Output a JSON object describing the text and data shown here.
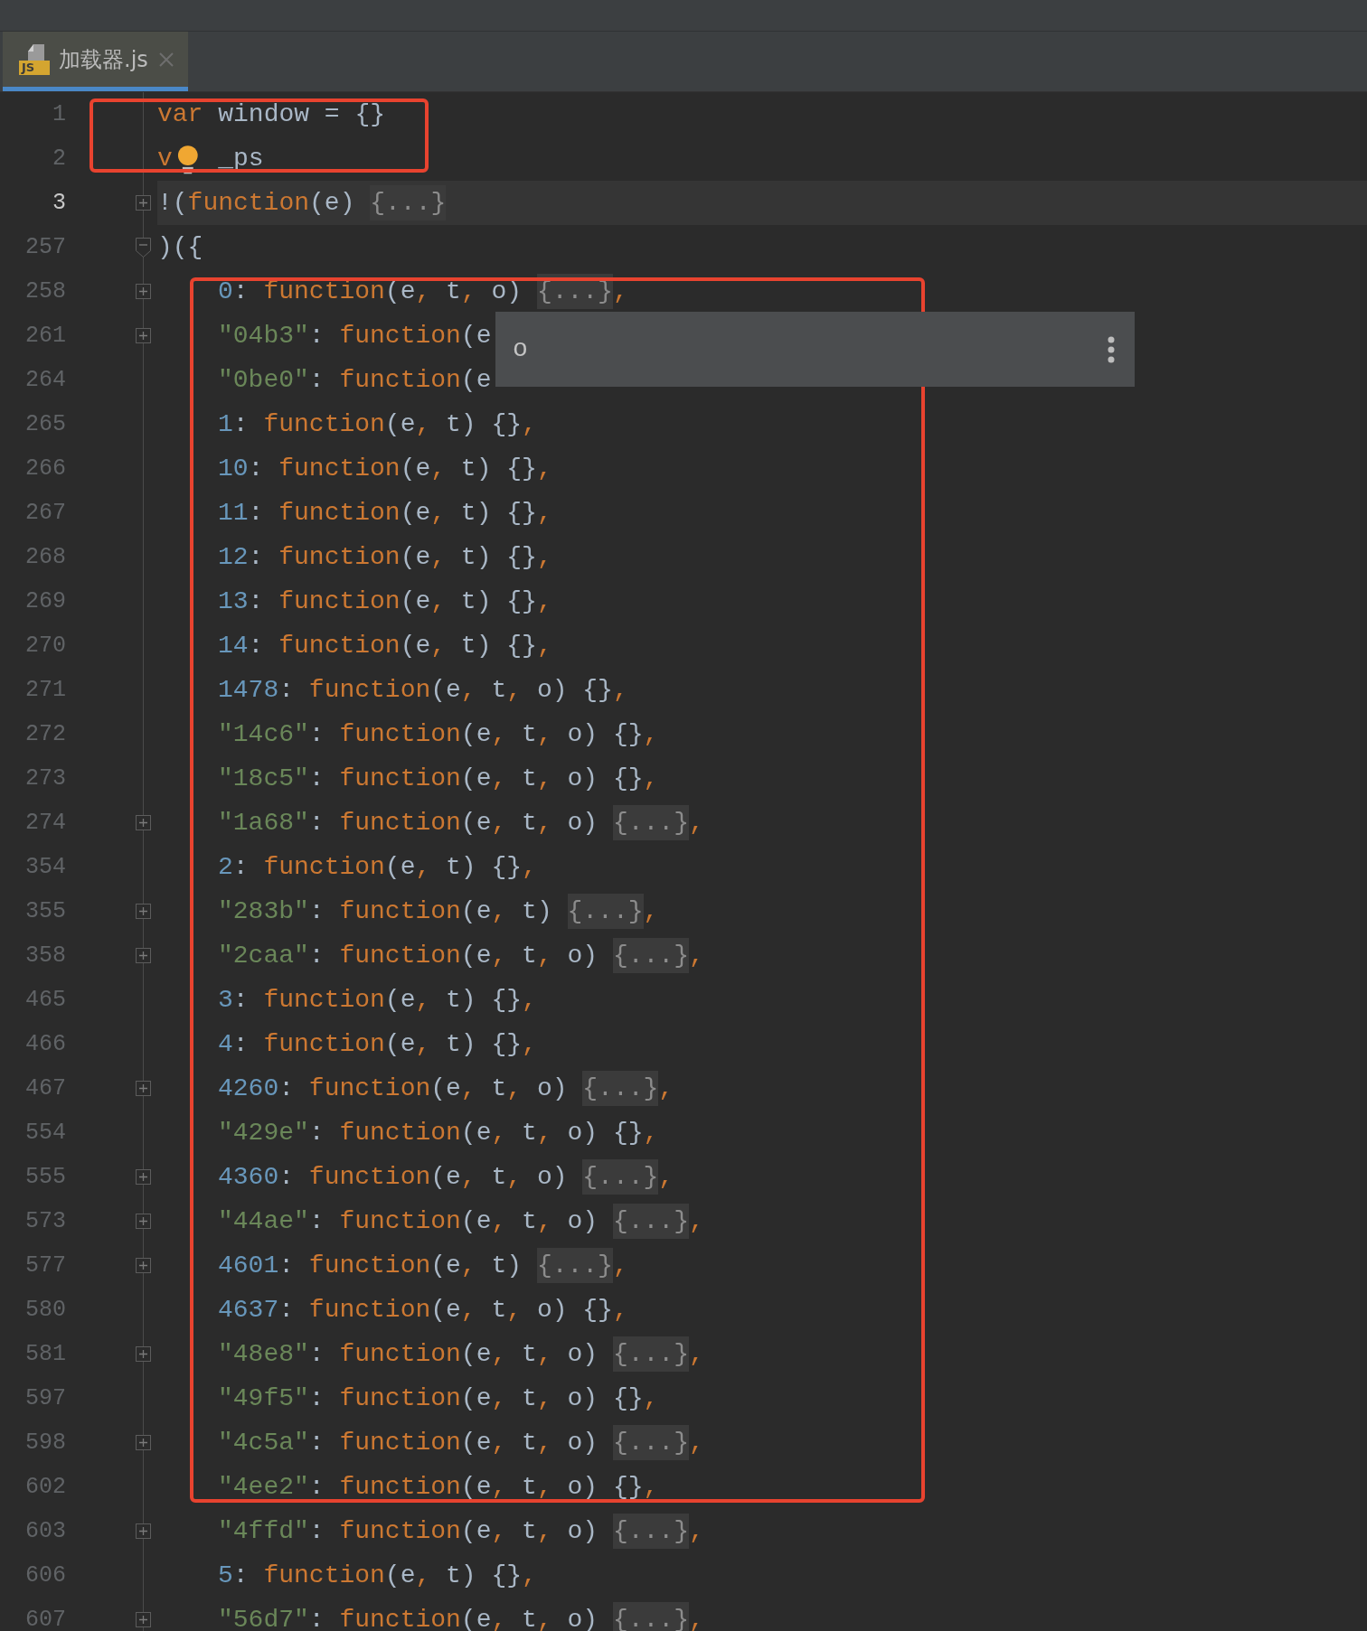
{
  "tab": {
    "title": "加载器.js",
    "icon_text": "JS",
    "selected": true
  },
  "lines": [
    {
      "number": "1",
      "current": false,
      "tokens": [
        {
          "kind": "keyword",
          "text": "var"
        },
        {
          "kind": "plain",
          "text": " window = {}"
        }
      ]
    },
    {
      "number": "2",
      "current": false,
      "tokens": [
        {
          "kind": "keyword",
          "text": "v"
        },
        {
          "kind": "bulb"
        },
        {
          "kind": "plain",
          "text": " _ps"
        }
      ]
    },
    {
      "number": "3",
      "current": true,
      "collapsed": true,
      "tokens": [
        {
          "kind": "plain",
          "text": "!("
        },
        {
          "kind": "keyword",
          "text": "function"
        },
        {
          "kind": "plain",
          "text": "(e) "
        },
        {
          "kind": "folded",
          "text": "{...}"
        }
      ]
    },
    {
      "number": "257",
      "current": false,
      "collapsed": false,
      "tokens": [
        {
          "kind": "plain",
          "text": ")({"
        }
      ],
      "children": [
        {
          "number": "258",
          "current": false,
          "collapsed": true,
          "tokens": [
            {
              "kind": "number",
              "text": "0"
            },
            {
              "kind": "plain",
              "text": ": "
            },
            {
              "kind": "keyword",
              "text": "function"
            },
            {
              "kind": "plain",
              "text": "(e"
            },
            {
              "kind": "keyword",
              "text": ", "
            },
            {
              "kind": "plain",
              "text": "t"
            },
            {
              "kind": "keyword",
              "text": ", "
            },
            {
              "kind": "plain",
              "text": "o) "
            },
            {
              "kind": "folded",
              "text": "{...}"
            },
            {
              "kind": "keyword",
              "text": ","
            }
          ]
        },
        {
          "number": "261",
          "current": false,
          "collapsed": true,
          "tokens": [
            {
              "kind": "string",
              "text": "\"04b3\""
            },
            {
              "kind": "plain",
              "text": ": "
            },
            {
              "kind": "keyword",
              "text": "function"
            },
            {
              "kind": "plain",
              "text": "(e"
            }
          ]
        },
        {
          "number": "264",
          "current": false,
          "tokens": [
            {
              "kind": "string",
              "text": "\"0be0\""
            },
            {
              "kind": "plain",
              "text": ": "
            },
            {
              "kind": "keyword",
              "text": "function"
            },
            {
              "kind": "plain",
              "text": "(e"
            }
          ]
        },
        {
          "number": "265",
          "current": false,
          "tokens": [
            {
              "kind": "number",
              "text": "1"
            },
            {
              "kind": "plain",
              "text": ": "
            },
            {
              "kind": "keyword",
              "text": "function"
            },
            {
              "kind": "plain",
              "text": "(e"
            },
            {
              "kind": "keyword",
              "text": ", "
            },
            {
              "kind": "plain",
              "text": "t) {}"
            },
            {
              "kind": "keyword",
              "text": ","
            }
          ]
        },
        {
          "number": "266",
          "current": false,
          "tokens": [
            {
              "kind": "number",
              "text": "10"
            },
            {
              "kind": "plain",
              "text": ": "
            },
            {
              "kind": "keyword",
              "text": "function"
            },
            {
              "kind": "plain",
              "text": "(e"
            },
            {
              "kind": "keyword",
              "text": ", "
            },
            {
              "kind": "plain",
              "text": "t) {}"
            },
            {
              "kind": "keyword",
              "text": ","
            }
          ]
        },
        {
          "number": "267",
          "current": false,
          "tokens": [
            {
              "kind": "number",
              "text": "11"
            },
            {
              "kind": "plain",
              "text": ": "
            },
            {
              "kind": "keyword",
              "text": "function"
            },
            {
              "kind": "plain",
              "text": "(e"
            },
            {
              "kind": "keyword",
              "text": ", "
            },
            {
              "kind": "plain",
              "text": "t) {}"
            },
            {
              "kind": "keyword",
              "text": ","
            }
          ]
        },
        {
          "number": "268",
          "current": false,
          "tokens": [
            {
              "kind": "number",
              "text": "12"
            },
            {
              "kind": "plain",
              "text": ": "
            },
            {
              "kind": "keyword",
              "text": "function"
            },
            {
              "kind": "plain",
              "text": "(e"
            },
            {
              "kind": "keyword",
              "text": ", "
            },
            {
              "kind": "plain",
              "text": "t) {}"
            },
            {
              "kind": "keyword",
              "text": ","
            }
          ]
        },
        {
          "number": "269",
          "current": false,
          "tokens": [
            {
              "kind": "number",
              "text": "13"
            },
            {
              "kind": "plain",
              "text": ": "
            },
            {
              "kind": "keyword",
              "text": "function"
            },
            {
              "kind": "plain",
              "text": "(e"
            },
            {
              "kind": "keyword",
              "text": ", "
            },
            {
              "kind": "plain",
              "text": "t) {}"
            },
            {
              "kind": "keyword",
              "text": ","
            }
          ]
        },
        {
          "number": "270",
          "current": false,
          "tokens": [
            {
              "kind": "number",
              "text": "14"
            },
            {
              "kind": "plain",
              "text": ": "
            },
            {
              "kind": "keyword",
              "text": "function"
            },
            {
              "kind": "plain",
              "text": "(e"
            },
            {
              "kind": "keyword",
              "text": ", "
            },
            {
              "kind": "plain",
              "text": "t) {}"
            },
            {
              "kind": "keyword",
              "text": ","
            }
          ]
        },
        {
          "number": "271",
          "current": false,
          "tokens": [
            {
              "kind": "number",
              "text": "1478"
            },
            {
              "kind": "plain",
              "text": ": "
            },
            {
              "kind": "keyword",
              "text": "function"
            },
            {
              "kind": "plain",
              "text": "(e"
            },
            {
              "kind": "keyword",
              "text": ", "
            },
            {
              "kind": "plain",
              "text": "t"
            },
            {
              "kind": "keyword",
              "text": ", "
            },
            {
              "kind": "plain",
              "text": "o) {}"
            },
            {
              "kind": "keyword",
              "text": ","
            }
          ]
        },
        {
          "number": "272",
          "current": false,
          "tokens": [
            {
              "kind": "string",
              "text": "\"14c6\""
            },
            {
              "kind": "plain",
              "text": ": "
            },
            {
              "kind": "keyword",
              "text": "function"
            },
            {
              "kind": "plain",
              "text": "(e"
            },
            {
              "kind": "keyword",
              "text": ", "
            },
            {
              "kind": "plain",
              "text": "t"
            },
            {
              "kind": "keyword",
              "text": ", "
            },
            {
              "kind": "plain",
              "text": "o) {}"
            },
            {
              "kind": "keyword",
              "text": ","
            }
          ]
        },
        {
          "number": "273",
          "current": false,
          "tokens": [
            {
              "kind": "string",
              "text": "\"18c5\""
            },
            {
              "kind": "plain",
              "text": ": "
            },
            {
              "kind": "keyword",
              "text": "function"
            },
            {
              "kind": "plain",
              "text": "(e"
            },
            {
              "kind": "keyword",
              "text": ", "
            },
            {
              "kind": "plain",
              "text": "t"
            },
            {
              "kind": "keyword",
              "text": ", "
            },
            {
              "kind": "plain",
              "text": "o) {}"
            },
            {
              "kind": "keyword",
              "text": ","
            }
          ]
        },
        {
          "number": "274",
          "current": false,
          "collapsed": true,
          "tokens": [
            {
              "kind": "string",
              "text": "\"1a68\""
            },
            {
              "kind": "plain",
              "text": ": "
            },
            {
              "kind": "keyword",
              "text": "function"
            },
            {
              "kind": "plain",
              "text": "(e"
            },
            {
              "kind": "keyword",
              "text": ", "
            },
            {
              "kind": "plain",
              "text": "t"
            },
            {
              "kind": "keyword",
              "text": ", "
            },
            {
              "kind": "plain",
              "text": "o) "
            },
            {
              "kind": "folded",
              "text": "{...}"
            },
            {
              "kind": "keyword",
              "text": ","
            }
          ]
        },
        {
          "number": "354",
          "current": false,
          "tokens": [
            {
              "kind": "number",
              "text": "2"
            },
            {
              "kind": "plain",
              "text": ": "
            },
            {
              "kind": "keyword",
              "text": "function"
            },
            {
              "kind": "plain",
              "text": "(e"
            },
            {
              "kind": "keyword",
              "text": ", "
            },
            {
              "kind": "plain",
              "text": "t) {}"
            },
            {
              "kind": "keyword",
              "text": ","
            }
          ]
        },
        {
          "number": "355",
          "current": false,
          "collapsed": true,
          "tokens": [
            {
              "kind": "string",
              "text": "\"283b\""
            },
            {
              "kind": "plain",
              "text": ": "
            },
            {
              "kind": "keyword",
              "text": "function"
            },
            {
              "kind": "plain",
              "text": "(e"
            },
            {
              "kind": "keyword",
              "text": ", "
            },
            {
              "kind": "plain",
              "text": "t) "
            },
            {
              "kind": "folded",
              "text": "{...}"
            },
            {
              "kind": "keyword",
              "text": ","
            }
          ]
        },
        {
          "number": "358",
          "current": false,
          "collapsed": true,
          "tokens": [
            {
              "kind": "string",
              "text": "\"2caa\""
            },
            {
              "kind": "plain",
              "text": ": "
            },
            {
              "kind": "keyword",
              "text": "function"
            },
            {
              "kind": "plain",
              "text": "(e"
            },
            {
              "kind": "keyword",
              "text": ", "
            },
            {
              "kind": "plain",
              "text": "t"
            },
            {
              "kind": "keyword",
              "text": ", "
            },
            {
              "kind": "plain",
              "text": "o) "
            },
            {
              "kind": "folded",
              "text": "{...}"
            },
            {
              "kind": "keyword",
              "text": ","
            }
          ]
        },
        {
          "number": "465",
          "current": false,
          "tokens": [
            {
              "kind": "number",
              "text": "3"
            },
            {
              "kind": "plain",
              "text": ": "
            },
            {
              "kind": "keyword",
              "text": "function"
            },
            {
              "kind": "plain",
              "text": "(e"
            },
            {
              "kind": "keyword",
              "text": ", "
            },
            {
              "kind": "plain",
              "text": "t) {}"
            },
            {
              "kind": "keyword",
              "text": ","
            }
          ]
        },
        {
          "number": "466",
          "current": false,
          "tokens": [
            {
              "kind": "number",
              "text": "4"
            },
            {
              "kind": "plain",
              "text": ": "
            },
            {
              "kind": "keyword",
              "text": "function"
            },
            {
              "kind": "plain",
              "text": "(e"
            },
            {
              "kind": "keyword",
              "text": ", "
            },
            {
              "kind": "plain",
              "text": "t) {}"
            },
            {
              "kind": "keyword",
              "text": ","
            }
          ]
        },
        {
          "number": "467",
          "current": false,
          "collapsed": true,
          "tokens": [
            {
              "kind": "number",
              "text": "4260"
            },
            {
              "kind": "plain",
              "text": ": "
            },
            {
              "kind": "keyword",
              "text": "function"
            },
            {
              "kind": "plain",
              "text": "(e"
            },
            {
              "kind": "keyword",
              "text": ", "
            },
            {
              "kind": "plain",
              "text": "t"
            },
            {
              "kind": "keyword",
              "text": ", "
            },
            {
              "kind": "plain",
              "text": "o) "
            },
            {
              "kind": "folded",
              "text": "{...}"
            },
            {
              "kind": "keyword",
              "text": ","
            }
          ]
        },
        {
          "number": "554",
          "current": false,
          "tokens": [
            {
              "kind": "string",
              "text": "\"429e\""
            },
            {
              "kind": "plain",
              "text": ": "
            },
            {
              "kind": "keyword",
              "text": "function"
            },
            {
              "kind": "plain",
              "text": "(e"
            },
            {
              "kind": "keyword",
              "text": ", "
            },
            {
              "kind": "plain",
              "text": "t"
            },
            {
              "kind": "keyword",
              "text": ", "
            },
            {
              "kind": "plain",
              "text": "o) {}"
            },
            {
              "kind": "keyword",
              "text": ","
            }
          ]
        },
        {
          "number": "555",
          "current": false,
          "collapsed": true,
          "tokens": [
            {
              "kind": "number",
              "text": "4360"
            },
            {
              "kind": "plain",
              "text": ": "
            },
            {
              "kind": "keyword",
              "text": "function"
            },
            {
              "kind": "plain",
              "text": "(e"
            },
            {
              "kind": "keyword",
              "text": ", "
            },
            {
              "kind": "plain",
              "text": "t"
            },
            {
              "kind": "keyword",
              "text": ", "
            },
            {
              "kind": "plain",
              "text": "o) "
            },
            {
              "kind": "folded",
              "text": "{...}"
            },
            {
              "kind": "keyword",
              "text": ","
            }
          ]
        },
        {
          "number": "573",
          "current": false,
          "collapsed": true,
          "tokens": [
            {
              "kind": "string",
              "text": "\"44ae\""
            },
            {
              "kind": "plain",
              "text": ": "
            },
            {
              "kind": "keyword",
              "text": "function"
            },
            {
              "kind": "plain",
              "text": "(e"
            },
            {
              "kind": "keyword",
              "text": ", "
            },
            {
              "kind": "plain",
              "text": "t"
            },
            {
              "kind": "keyword",
              "text": ", "
            },
            {
              "kind": "plain",
              "text": "o) "
            },
            {
              "kind": "folded",
              "text": "{...}"
            },
            {
              "kind": "keyword",
              "text": ","
            }
          ]
        },
        {
          "number": "577",
          "current": false,
          "collapsed": true,
          "tokens": [
            {
              "kind": "number",
              "text": "4601"
            },
            {
              "kind": "plain",
              "text": ": "
            },
            {
              "kind": "keyword",
              "text": "function"
            },
            {
              "kind": "plain",
              "text": "(e"
            },
            {
              "kind": "keyword",
              "text": ", "
            },
            {
              "kind": "plain",
              "text": "t) "
            },
            {
              "kind": "folded",
              "text": "{...}"
            },
            {
              "kind": "keyword",
              "text": ","
            }
          ]
        },
        {
          "number": "580",
          "current": false,
          "tokens": [
            {
              "kind": "number",
              "text": "4637"
            },
            {
              "kind": "plain",
              "text": ": "
            },
            {
              "kind": "keyword",
              "text": "function"
            },
            {
              "kind": "plain",
              "text": "(e"
            },
            {
              "kind": "keyword",
              "text": ", "
            },
            {
              "kind": "plain",
              "text": "t"
            },
            {
              "kind": "keyword",
              "text": ", "
            },
            {
              "kind": "plain",
              "text": "o) {}"
            },
            {
              "kind": "keyword",
              "text": ","
            }
          ]
        },
        {
          "number": "581",
          "current": false,
          "collapsed": true,
          "tokens": [
            {
              "kind": "string",
              "text": "\"48e8\""
            },
            {
              "kind": "plain",
              "text": ": "
            },
            {
              "kind": "keyword",
              "text": "function"
            },
            {
              "kind": "plain",
              "text": "(e"
            },
            {
              "kind": "keyword",
              "text": ", "
            },
            {
              "kind": "plain",
              "text": "t"
            },
            {
              "kind": "keyword",
              "text": ", "
            },
            {
              "kind": "plain",
              "text": "o) "
            },
            {
              "kind": "folded",
              "text": "{...}"
            },
            {
              "kind": "keyword",
              "text": ","
            }
          ]
        },
        {
          "number": "597",
          "current": false,
          "tokens": [
            {
              "kind": "string",
              "text": "\"49f5\""
            },
            {
              "kind": "plain",
              "text": ": "
            },
            {
              "kind": "keyword",
              "text": "function"
            },
            {
              "kind": "plain",
              "text": "(e"
            },
            {
              "kind": "keyword",
              "text": ", "
            },
            {
              "kind": "plain",
              "text": "t"
            },
            {
              "kind": "keyword",
              "text": ", "
            },
            {
              "kind": "plain",
              "text": "o) {}"
            },
            {
              "kind": "keyword",
              "text": ","
            }
          ]
        },
        {
          "number": "598",
          "current": false,
          "collapsed": true,
          "tokens": [
            {
              "kind": "string",
              "text": "\"4c5a\""
            },
            {
              "kind": "plain",
              "text": ": "
            },
            {
              "kind": "keyword",
              "text": "function"
            },
            {
              "kind": "plain",
              "text": "(e"
            },
            {
              "kind": "keyword",
              "text": ", "
            },
            {
              "kind": "plain",
              "text": "t"
            },
            {
              "kind": "keyword",
              "text": ", "
            },
            {
              "kind": "plain",
              "text": "o) "
            },
            {
              "kind": "folded",
              "text": "{...}"
            },
            {
              "kind": "keyword",
              "text": ","
            }
          ]
        },
        {
          "number": "602",
          "current": false,
          "tokens": [
            {
              "kind": "string",
              "text": "\"4ee2\""
            },
            {
              "kind": "plain",
              "text": ": "
            },
            {
              "kind": "keyword",
              "text": "function"
            },
            {
              "kind": "plain",
              "text": "(e"
            },
            {
              "kind": "keyword",
              "text": ", "
            },
            {
              "kind": "plain",
              "text": "t"
            },
            {
              "kind": "keyword",
              "text": ", "
            },
            {
              "kind": "plain",
              "text": "o) {}"
            },
            {
              "kind": "keyword",
              "text": ","
            }
          ]
        },
        {
          "number": "603",
          "current": false,
          "collapsed": true,
          "tokens": [
            {
              "kind": "string",
              "text": "\"4ffd\""
            },
            {
              "kind": "plain",
              "text": ": "
            },
            {
              "kind": "keyword",
              "text": "function"
            },
            {
              "kind": "plain",
              "text": "(e"
            },
            {
              "kind": "keyword",
              "text": ", "
            },
            {
              "kind": "plain",
              "text": "t"
            },
            {
              "kind": "keyword",
              "text": ", "
            },
            {
              "kind": "plain",
              "text": "o) "
            },
            {
              "kind": "folded",
              "text": "{...}"
            },
            {
              "kind": "keyword",
              "text": ","
            }
          ]
        },
        {
          "number": "606",
          "current": false,
          "tokens": [
            {
              "kind": "number",
              "text": "5"
            },
            {
              "kind": "plain",
              "text": ": "
            },
            {
              "kind": "keyword",
              "text": "function"
            },
            {
              "kind": "plain",
              "text": "(e"
            },
            {
              "kind": "keyword",
              "text": ", "
            },
            {
              "kind": "plain",
              "text": "t) {}"
            },
            {
              "kind": "keyword",
              "text": ","
            }
          ]
        },
        {
          "number": "607",
          "current": false,
          "collapsed": true,
          "tokens": [
            {
              "kind": "string",
              "text": "\"56d7\""
            },
            {
              "kind": "plain",
              "text": ": "
            },
            {
              "kind": "keyword",
              "text": "function"
            },
            {
              "kind": "plain",
              "text": "(e"
            },
            {
              "kind": "keyword",
              "text": ", "
            },
            {
              "kind": "plain",
              "text": "t"
            },
            {
              "kind": "keyword",
              "text": ", "
            },
            {
              "kind": "plain",
              "text": "o) "
            },
            {
              "kind": "folded",
              "text": "{...}"
            },
            {
              "kind": "keyword",
              "text": ","
            }
          ]
        }
      ]
    }
  ],
  "tooltip": {
    "text": "o"
  }
}
